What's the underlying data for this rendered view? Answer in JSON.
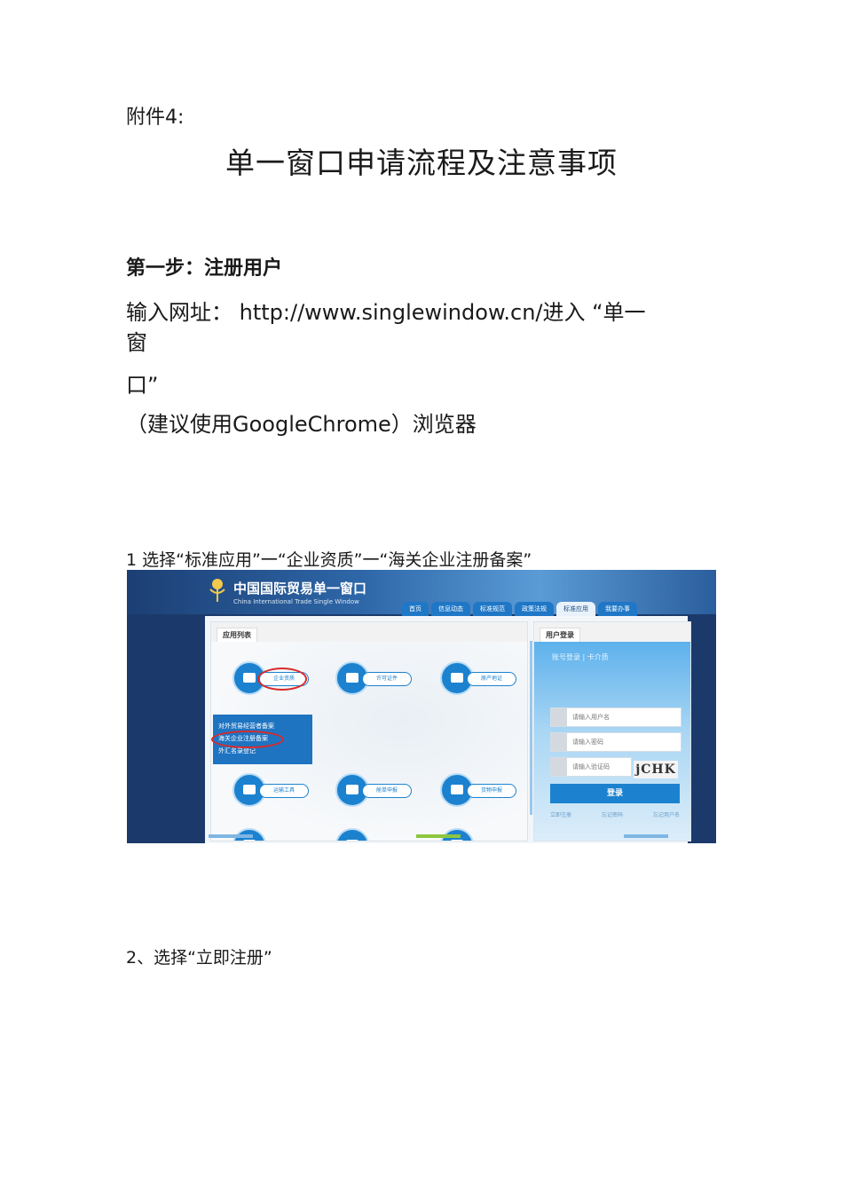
{
  "document": {
    "attachment_label": "附件4:",
    "title": "单一窗口申请流程及注意事项",
    "step1_heading": "第一步：注册用户",
    "url_line_1": "输入网址： http://www.singlewindow.cn/进入 “单一",
    "url_line_2": "窗",
    "url_line_3": "口”",
    "browser_note": "（建议使用GoogleChrome）浏览器",
    "caption_1": "1 选择“标准应用”一“企业资质”一“海关企业注册备案”",
    "caption_2": "2、选择“立即注册”"
  },
  "screenshot": {
    "site_name_cn": "中国国际贸易单一窗口",
    "site_name_en": "China International Trade Single Window",
    "nav_tabs": [
      "首页",
      "信息动态",
      "标准规范",
      "政策法规",
      "标准应用",
      "我要办事"
    ],
    "active_tab": "标准应用",
    "app_list_title": "应用列表",
    "apps": [
      "企业资质",
      "许可证件",
      "原产地证",
      "运输工具",
      "舱单申报",
      "货物申报"
    ],
    "dropdown_items": [
      "对外贸易经营者备案",
      "海关企业注册备案",
      "外汇名录登记"
    ],
    "login_title": "用户登录",
    "login_types": "账号登录 | 卡介质",
    "username_placeholder": "请输入用户名",
    "password_placeholder": "请输入密码",
    "captcha_placeholder": "请输入验证码",
    "captcha_text": "jCHK",
    "login_button": "登录",
    "login_links": [
      "立即注册",
      "忘记密码",
      "忘记用户名"
    ],
    "colors": {
      "accent": "#1c82cf",
      "highlight": "#d92a2a",
      "banner": "#1c3f74"
    }
  }
}
